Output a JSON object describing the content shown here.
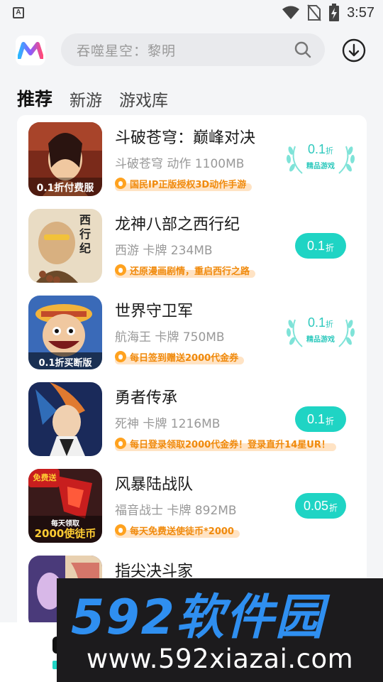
{
  "status_bar": {
    "notification_icon_letter": "A",
    "time": "3:57"
  },
  "header": {
    "search_placeholder": "吞噬星空：黎明"
  },
  "tabs": [
    {
      "label": "推荐",
      "active": true
    },
    {
      "label": "新游",
      "active": false
    },
    {
      "label": "游戏库",
      "active": false
    }
  ],
  "games": [
    {
      "name": "斗破苍穹：巅峰对决",
      "meta": "斗破苍穹 动作 1100MB",
      "promo": "国民IP正版授权3D动作手游",
      "discount": "0.1",
      "discount_unit": "折",
      "badge_style": "laurel",
      "badge_sub": "精品游戏",
      "icon_text": "0.1折付费服",
      "icon_colors": [
        "#7a2a1a",
        "#c8643a",
        "#f0c8a0"
      ]
    },
    {
      "name": "龙神八部之西行纪",
      "meta": "西游 卡牌 234MB",
      "promo": "还原漫画剧情，重启西行之路",
      "discount": "0.1",
      "discount_unit": "折",
      "badge_style": "pill",
      "icon_text": "西行纪",
      "icon_colors": [
        "#e9dcc4",
        "#6b4a2a",
        "#d8b080"
      ]
    },
    {
      "name": "世界守卫军",
      "meta": "航海王 卡牌 750MB",
      "promo": "每日签到赠送2000代金券",
      "discount": "0.1",
      "discount_unit": "折",
      "badge_style": "laurel",
      "badge_sub": "精品游戏",
      "icon_text": "0.1折买断版",
      "icon_colors": [
        "#c24a2a",
        "#f2b33c",
        "#3a6ab8"
      ]
    },
    {
      "name": "勇者传承",
      "meta": "死神 卡牌 1216MB",
      "promo": "每日登录领取2000代金券！登录直升14星UR！",
      "discount": "0.1",
      "discount_unit": "折",
      "badge_style": "pill",
      "icon_text": "",
      "icon_colors": [
        "#1a2a5a",
        "#e07a30",
        "#f0f0f0"
      ]
    },
    {
      "name": "风暴陆战队",
      "meta": "福音战士 卡牌 892MB",
      "promo": "每天免费送使徒币*2000",
      "discount": "0.05",
      "discount_unit": "折",
      "badge_style": "pill",
      "icon_text": "2000使徒币",
      "icon_top_text": "免费送",
      "icon_mid_text": "每天领取",
      "icon_colors": [
        "#c81e1e",
        "#3a1a1a",
        "#ffcc33"
      ]
    },
    {
      "name": "指尖决斗家",
      "meta": "",
      "promo": "",
      "discount": "",
      "discount_unit": "",
      "badge_style": "none",
      "icon_text": "",
      "icon_colors": [
        "#4a3a7a",
        "#e8d0b0",
        "#c83a3a"
      ]
    }
  ],
  "watermark": {
    "title": "592软件园",
    "url": "www.592xiazai.com"
  },
  "colors": {
    "accent_teal": "#1fd4c4",
    "promo_orange": "#f08a0c",
    "background": "#f4f5f7"
  }
}
